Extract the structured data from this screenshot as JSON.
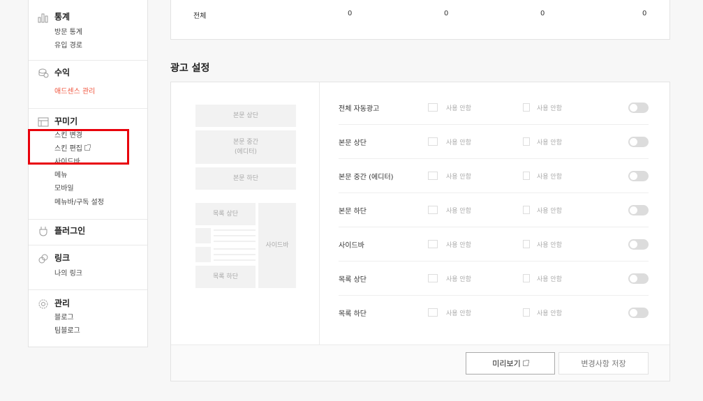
{
  "sidebar": {
    "sections": [
      {
        "title": "통계",
        "icon": "bar-chart-icon",
        "items": [
          "방문 통계",
          "유입 경로"
        ]
      },
      {
        "title": "수익",
        "icon": "coins-icon",
        "items": [
          "애드센스 관리"
        ]
      },
      {
        "title": "꾸미기",
        "icon": "layout-icon",
        "items": [
          "스킨 변경",
          "스킨 편집",
          "사이드바",
          "메뉴",
          "모바일",
          "메뉴바/구독 설정"
        ]
      },
      {
        "title": "플러그인",
        "icon": "plug-icon",
        "items": []
      },
      {
        "title": "링크",
        "icon": "link-icon",
        "items": [
          "나의 링크"
        ]
      },
      {
        "title": "관리",
        "icon": "gear-icon",
        "items": [
          "블로그",
          "팀블로그"
        ]
      }
    ]
  },
  "summary": {
    "label": "전체",
    "values": [
      "0",
      "0",
      "0",
      "0"
    ]
  },
  "ad_settings": {
    "title": "광고 설정",
    "preview": {
      "body_top": "본문 상단",
      "body_middle_line1": "본문 중간",
      "body_middle_line2": "(에디터)",
      "body_bottom": "본문 하단",
      "list_top": "목록 상단",
      "sidebar": "사이드바",
      "list_bottom": "목록 하단"
    },
    "option_label": "사용 안함",
    "rows": [
      {
        "label": "전체 자동광고"
      },
      {
        "label": "본문 상단"
      },
      {
        "label": "본문 중간 (에디터)"
      },
      {
        "label": "본문 하단"
      },
      {
        "label": "사이드바"
      },
      {
        "label": "목록 상단"
      },
      {
        "label": "목록 하단"
      }
    ],
    "preview_button": "미리보기",
    "save_button": "변경사항 저장"
  },
  "colors": {
    "accent": "#f0553e",
    "highlight_box": "#e8000b"
  }
}
